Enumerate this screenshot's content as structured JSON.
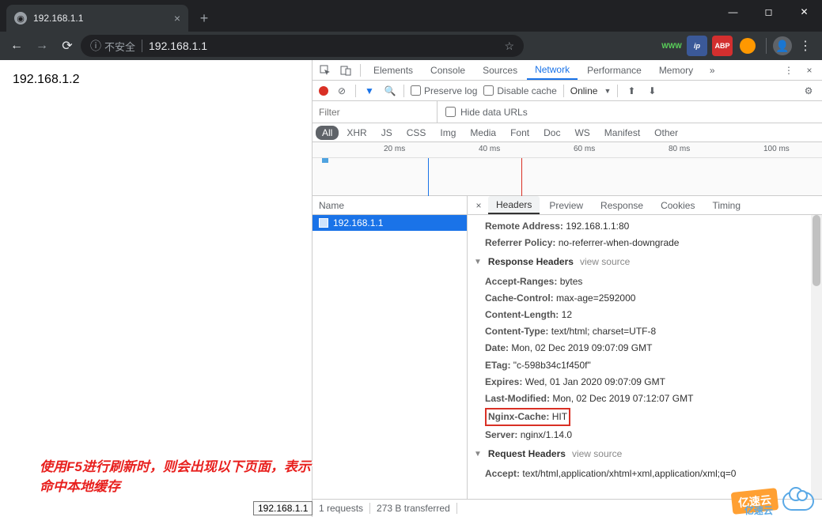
{
  "browser": {
    "tab_title": "192.168.1.1",
    "omnibox": {
      "insecure_label": "不安全",
      "url": "192.168.1.1"
    },
    "extensions": {
      "www": "WWW",
      "ip": "ip",
      "abp": "ABP"
    }
  },
  "page_body": "192.168.1.2",
  "annotation": "使用F5进行刷新时，则会出现以下页面，表示命中本地缓存",
  "tooltip": "192.168.1.1",
  "devtools": {
    "tabs": {
      "elements": "Elements",
      "console": "Console",
      "sources": "Sources",
      "network": "Network",
      "performance": "Performance",
      "memory": "Memory"
    },
    "toolbar": {
      "preserve_log": "Preserve log",
      "disable_cache": "Disable cache",
      "online": "Online"
    },
    "filter_placeholder": "Filter",
    "hide_urls": "Hide data URLs",
    "types": {
      "all": "All",
      "xhr": "XHR",
      "js": "JS",
      "css": "CSS",
      "img": "Img",
      "media": "Media",
      "font": "Font",
      "doc": "Doc",
      "ws": "WS",
      "manifest": "Manifest",
      "other": "Other"
    },
    "timeline": {
      "t20": "20 ms",
      "t40": "40 ms",
      "t60": "60 ms",
      "t80": "80 ms",
      "t100": "100 ms"
    },
    "name_col": "Name",
    "request_name": "192.168.1.1",
    "detail_tabs": {
      "headers": "Headers",
      "preview": "Preview",
      "response": "Response",
      "cookies": "Cookies",
      "timing": "Timing"
    },
    "headers": {
      "remote_addr_k": "Remote Address:",
      "remote_addr_v": "192.168.1.1:80",
      "ref_policy_k": "Referrer Policy:",
      "ref_policy_v": "no-referrer-when-downgrade",
      "resp_section": "Response Headers",
      "view_source": "view source",
      "accept_ranges_k": "Accept-Ranges:",
      "accept_ranges_v": "bytes",
      "cache_control_k": "Cache-Control:",
      "cache_control_v": "max-age=2592000",
      "content_length_k": "Content-Length:",
      "content_length_v": "12",
      "content_type_k": "Content-Type:",
      "content_type_v": "text/html; charset=UTF-8",
      "date_k": "Date:",
      "date_v": "Mon, 02 Dec 2019 09:07:09 GMT",
      "etag_k": "ETag:",
      "etag_v": "\"c-598b34c1f450f\"",
      "expires_k": "Expires:",
      "expires_v": "Wed, 01 Jan 2020 09:07:09 GMT",
      "last_mod_k": "Last-Modified:",
      "last_mod_v": "Mon, 02 Dec 2019 07:12:07 GMT",
      "nginx_cache_k": "Nginx-Cache:",
      "nginx_cache_v": "HIT",
      "server_k": "Server:",
      "server_v": "nginx/1.14.0",
      "req_section": "Request Headers",
      "accept_k": "Accept:",
      "accept_v": "text/html,application/xhtml+xml,application/xml;q=0"
    },
    "status": {
      "requests": "1 requests",
      "transferred": "273 B transferred"
    }
  },
  "watermark": "亿速云"
}
